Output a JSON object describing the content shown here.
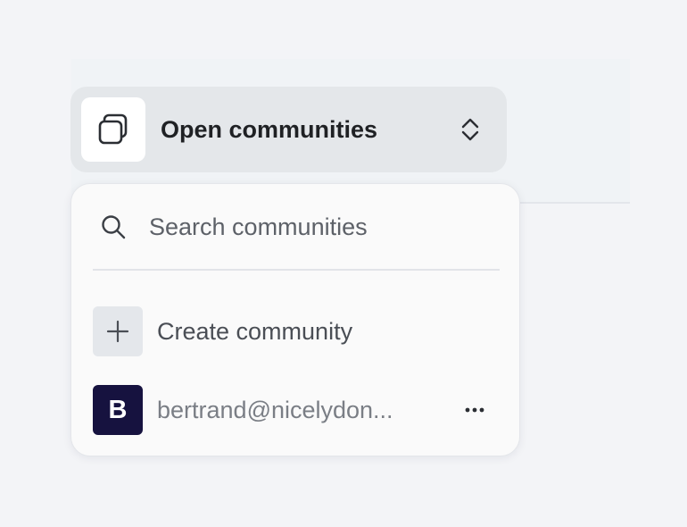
{
  "switcher": {
    "label": "Open communities",
    "icon": "stacked-squares-icon",
    "chevron_icon": "chevron-up-down-icon"
  },
  "dropdown": {
    "search": {
      "placeholder": "Search communities",
      "value": "",
      "icon": "search-icon"
    },
    "create": {
      "label": "Create community",
      "icon": "plus-icon"
    },
    "communities": [
      {
        "avatar_letter": "B",
        "name": "bertrand@nicelydon...",
        "more_icon": "more-horizontal-icon"
      }
    ]
  },
  "colors": {
    "page_bg": "#f3f4f7",
    "switcher_bg": "#e4e7ea",
    "dropdown_bg": "#fafafa",
    "avatar_bg": "#16123f",
    "text_primary": "#1f2124",
    "text_secondary": "#7a7e85"
  }
}
